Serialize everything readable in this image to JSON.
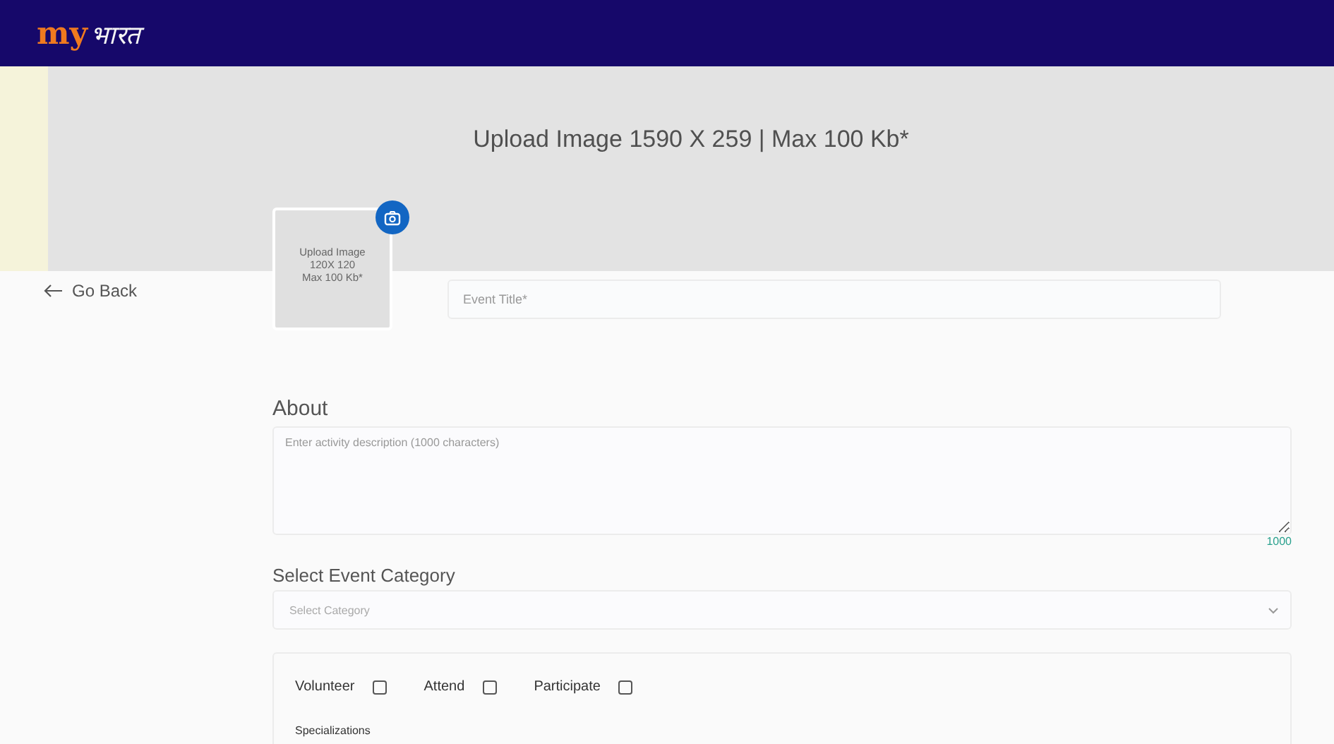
{
  "header": {
    "logo": {
      "latin": "my",
      "devanagari": "भारत"
    }
  },
  "banner": {
    "text": "Upload Image 1590 X 259 | Max 100 Kb*"
  },
  "go_back": {
    "label": "Go Back"
  },
  "image_upload": {
    "lines": [
      "Upload Image",
      "120X 120",
      "Max 100 Kb*"
    ]
  },
  "event_title": {
    "placeholder": "Event Title*"
  },
  "about": {
    "heading": "About",
    "placeholder": "Enter activity description (1000 characters)",
    "counter": "1000"
  },
  "category": {
    "heading": "Select Event Category",
    "placeholder": "Select Category"
  },
  "roles": [
    {
      "label": "Volunteer",
      "checked": false
    },
    {
      "label": "Attend",
      "checked": false
    },
    {
      "label": "Participate",
      "checked": false
    }
  ],
  "specializations": {
    "heading": "Specializations"
  }
}
